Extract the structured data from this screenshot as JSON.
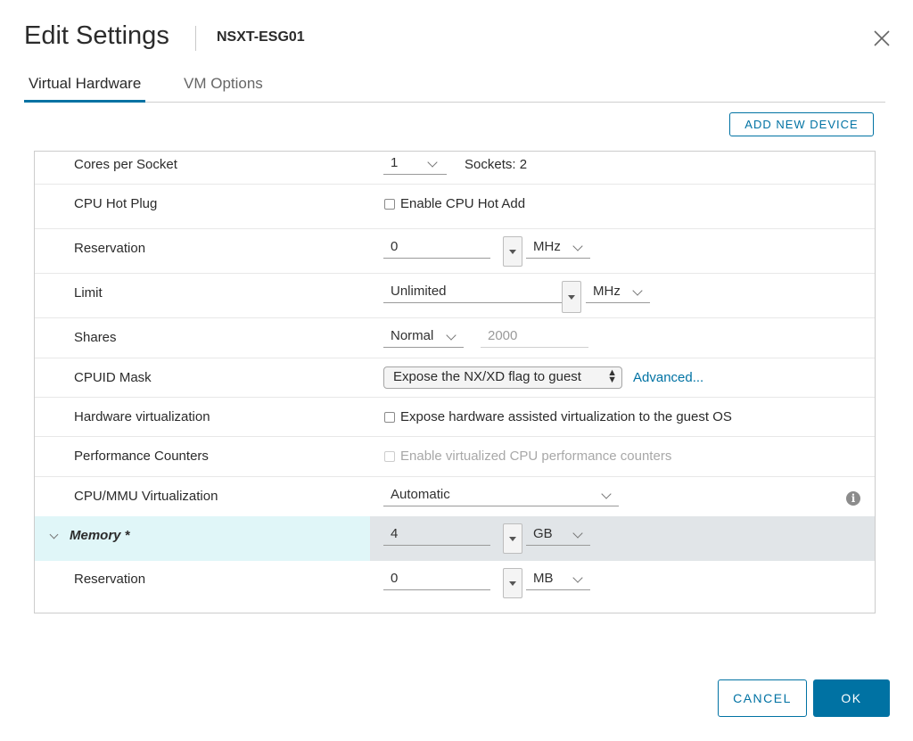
{
  "header": {
    "title": "Edit Settings",
    "vm_name": "NSXT-ESG01"
  },
  "tabs": [
    {
      "label": "Virtual Hardware",
      "active": true
    },
    {
      "label": "VM Options",
      "active": false
    }
  ],
  "toolbar": {
    "add_device_label": "ADD NEW DEVICE"
  },
  "rows": {
    "cores": {
      "label": "Cores per Socket",
      "value": "1",
      "sockets_text": "Sockets: 2"
    },
    "hotplug": {
      "label": "CPU Hot Plug",
      "checkbox_label": "Enable CPU Hot Add",
      "checked": false
    },
    "reservation": {
      "label": "Reservation",
      "value": "0",
      "unit": "MHz"
    },
    "limit": {
      "label": "Limit",
      "value": "Unlimited",
      "unit": "MHz"
    },
    "shares": {
      "label": "Shares",
      "value": "Normal",
      "number": "2000"
    },
    "cpuid": {
      "label": "CPUID Mask",
      "value": "Expose the NX/XD flag to guest",
      "link": "Advanced..."
    },
    "hwvirt": {
      "label": "Hardware virtualization",
      "checkbox_label": "Expose hardware assisted virtualization to the guest OS",
      "checked": false
    },
    "perf": {
      "label": "Performance Counters",
      "checkbox_label": "Enable virtualized CPU performance counters",
      "checked": false,
      "disabled": true
    },
    "mmu": {
      "label": "CPU/MMU Virtualization",
      "value": "Automatic"
    },
    "memory": {
      "label": "Memory *",
      "value": "4",
      "unit": "GB"
    },
    "mem_reservation": {
      "label": "Reservation",
      "value": "0",
      "unit": "MB"
    }
  },
  "footer": {
    "cancel_label": "CANCEL",
    "ok_label": "OK"
  },
  "colors": {
    "accent": "#0072a3",
    "memory_highlight": "#e0f6f8",
    "memory_row_bg": "#e1e5e8"
  }
}
